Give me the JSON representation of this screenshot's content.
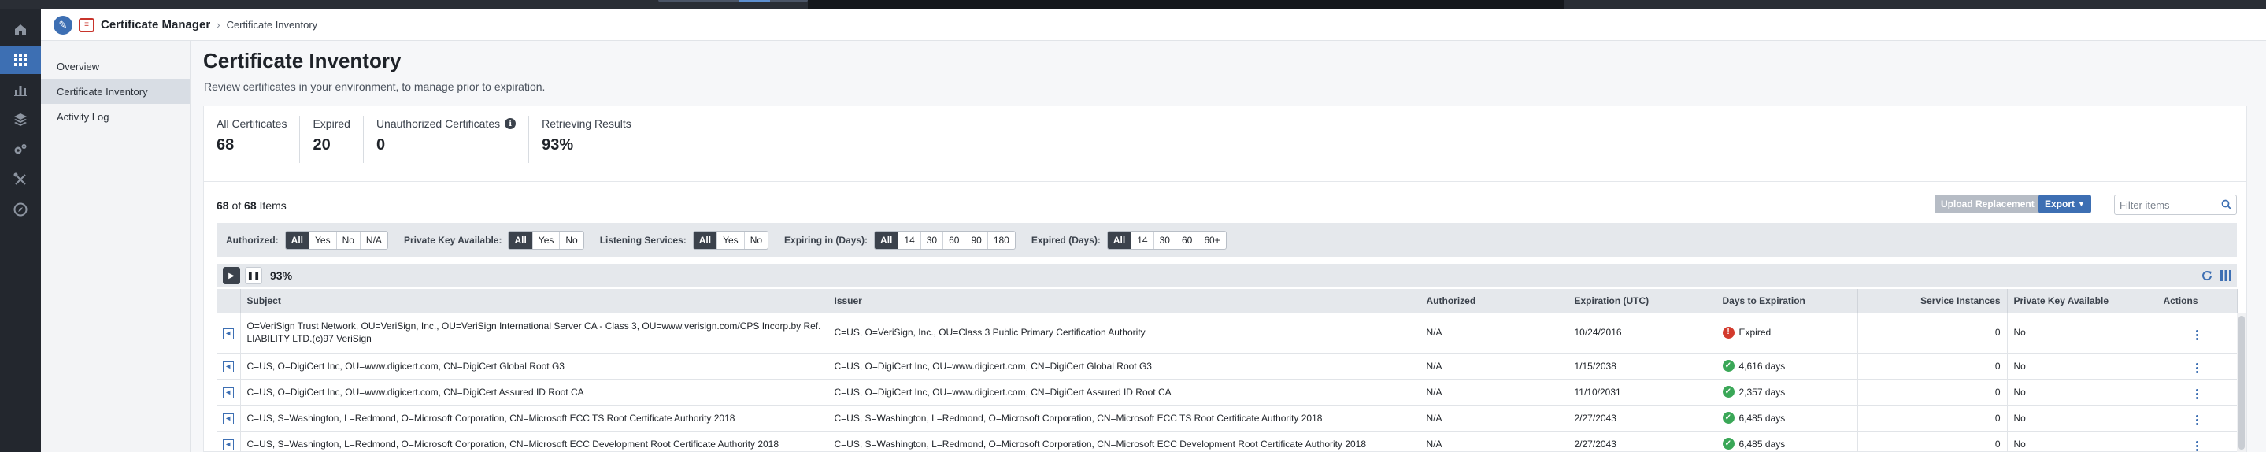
{
  "breadcrumb": {
    "app": "Certificate Manager",
    "separator": "›",
    "page": "Certificate Inventory"
  },
  "rail": {
    "icons": [
      "home-icon",
      "apps-grid-icon",
      "bar-chart-icon",
      "layers-icon",
      "gears-icon",
      "tools-icon",
      "compass-icon"
    ],
    "active": "apps-grid-icon"
  },
  "subnav": {
    "items": [
      {
        "label": "Overview"
      },
      {
        "label": "Certificate Inventory"
      },
      {
        "label": "Activity Log"
      }
    ],
    "active": "Certificate Inventory"
  },
  "page": {
    "title": "Certificate Inventory",
    "subtitle": "Review certificates in your environment, to manage prior to expiration."
  },
  "stats": [
    {
      "label": "All Certificates",
      "value": "68"
    },
    {
      "label": "Expired",
      "value": "20"
    },
    {
      "label": "Unauthorized Certificates",
      "value": "0",
      "info_icon": "info-icon"
    },
    {
      "label": "Retrieving Results",
      "value": "93%"
    }
  ],
  "list": {
    "shown": "68",
    "of": "of",
    "total": "68",
    "items_label": "Items",
    "upload_label": "Upload Replacement",
    "export_label": "Export",
    "filter_placeholder": "Filter items"
  },
  "filters": [
    {
      "label": "Authorized:",
      "options": [
        "All",
        "Yes",
        "No",
        "N/A"
      ],
      "selected": "All"
    },
    {
      "label": "Private Key Available:",
      "options": [
        "All",
        "Yes",
        "No"
      ],
      "selected": "All"
    },
    {
      "label": "Listening Services:",
      "options": [
        "All",
        "Yes",
        "No"
      ],
      "selected": "All"
    },
    {
      "label": "Expiring in (Days):",
      "options": [
        "All",
        "14",
        "30",
        "60",
        "90",
        "180"
      ],
      "selected": "All"
    },
    {
      "label": "Expired (Days):",
      "options": [
        "All",
        "14",
        "30",
        "60",
        "60+"
      ],
      "selected": "All"
    }
  ],
  "progress": {
    "percent_label": "93%",
    "percent": 93
  },
  "table": {
    "columns": [
      "",
      "Subject",
      "Issuer",
      "Authorized",
      "Expiration (UTC)",
      "Days to Expiration",
      "Service Instances",
      "Private Key Available",
      "Actions"
    ],
    "rows": [
      {
        "subject": "O=VeriSign Trust Network, OU=VeriSign, Inc., OU=VeriSign International Server CA - Class 3, OU=www.verisign.com/CPS Incorp.by Ref. LIABILITY LTD.(c)97 VeriSign",
        "issuer": "C=US, O=VeriSign, Inc., OU=Class 3 Public Primary Certification Authority",
        "authorized": "N/A",
        "expiration": "10/24/2016",
        "days": "Expired",
        "status": "expired",
        "instances": "0",
        "private_key": "No"
      },
      {
        "subject": "C=US, O=DigiCert Inc, OU=www.digicert.com, CN=DigiCert Global Root G3",
        "issuer": "C=US, O=DigiCert Inc, OU=www.digicert.com, CN=DigiCert Global Root G3",
        "authorized": "N/A",
        "expiration": "1/15/2038",
        "days": "4,616 days",
        "status": "ok",
        "instances": "0",
        "private_key": "No"
      },
      {
        "subject": "C=US, O=DigiCert Inc, OU=www.digicert.com, CN=DigiCert Assured ID Root CA",
        "issuer": "C=US, O=DigiCert Inc, OU=www.digicert.com, CN=DigiCert Assured ID Root CA",
        "authorized": "N/A",
        "expiration": "11/10/2031",
        "days": "2,357 days",
        "status": "ok",
        "instances": "0",
        "private_key": "No"
      },
      {
        "subject": "C=US, S=Washington, L=Redmond, O=Microsoft Corporation, CN=Microsoft ECC TS Root Certificate Authority 2018",
        "issuer": "C=US, S=Washington, L=Redmond, O=Microsoft Corporation, CN=Microsoft ECC TS Root Certificate Authority 2018",
        "authorized": "N/A",
        "expiration": "2/27/2043",
        "days": "6,485 days",
        "status": "ok",
        "instances": "0",
        "private_key": "No"
      },
      {
        "subject": "C=US, S=Washington, L=Redmond, O=Microsoft Corporation, CN=Microsoft ECC Development Root Certificate Authority 2018",
        "issuer": "C=US, S=Washington, L=Redmond, O=Microsoft Corporation, CN=Microsoft ECC Development Root Certificate Authority 2018",
        "authorized": "N/A",
        "expiration": "2/27/2043",
        "days": "6,485 days",
        "status": "ok",
        "instances": "0",
        "private_key": "No"
      }
    ]
  },
  "colors": {
    "accent": "#3d6fb3",
    "expired": "#d33a2c",
    "ok": "#3aa757",
    "rail": "#23272e"
  }
}
